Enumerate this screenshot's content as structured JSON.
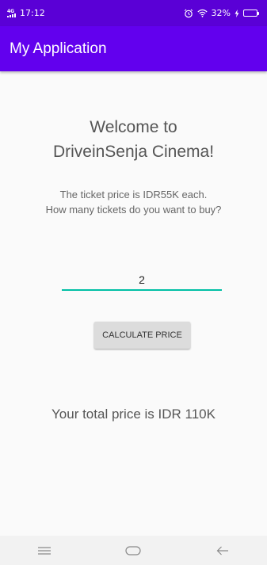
{
  "status_bar": {
    "network": "4G",
    "time": "17:12",
    "alarm_icon": "alarm-icon",
    "wifi_icon": "wifi-icon",
    "battery_percent": "32%",
    "battery_level": 0.32,
    "charging": true
  },
  "app_bar": {
    "title": "My Application"
  },
  "main": {
    "welcome_line1": "Welcome to",
    "welcome_line2": "DriveinSenja Cinema!",
    "prompt_line1": "The ticket price is IDR55K each.",
    "prompt_line2": "How many tickets do you want to buy?",
    "ticket_count": "2",
    "calculate_label": "CALCULATE PRICE",
    "total_text": "Your total price is IDR 110K"
  },
  "nav_bar": {
    "menu_icon": "menu-icon",
    "home_icon": "home-icon",
    "back_icon": "back-icon"
  },
  "colors": {
    "status_bar": "#5a00d6",
    "app_bar": "#6200ee",
    "input_underline": "#00bfa5",
    "button": "#dcdcdc",
    "background": "#fafafa"
  }
}
